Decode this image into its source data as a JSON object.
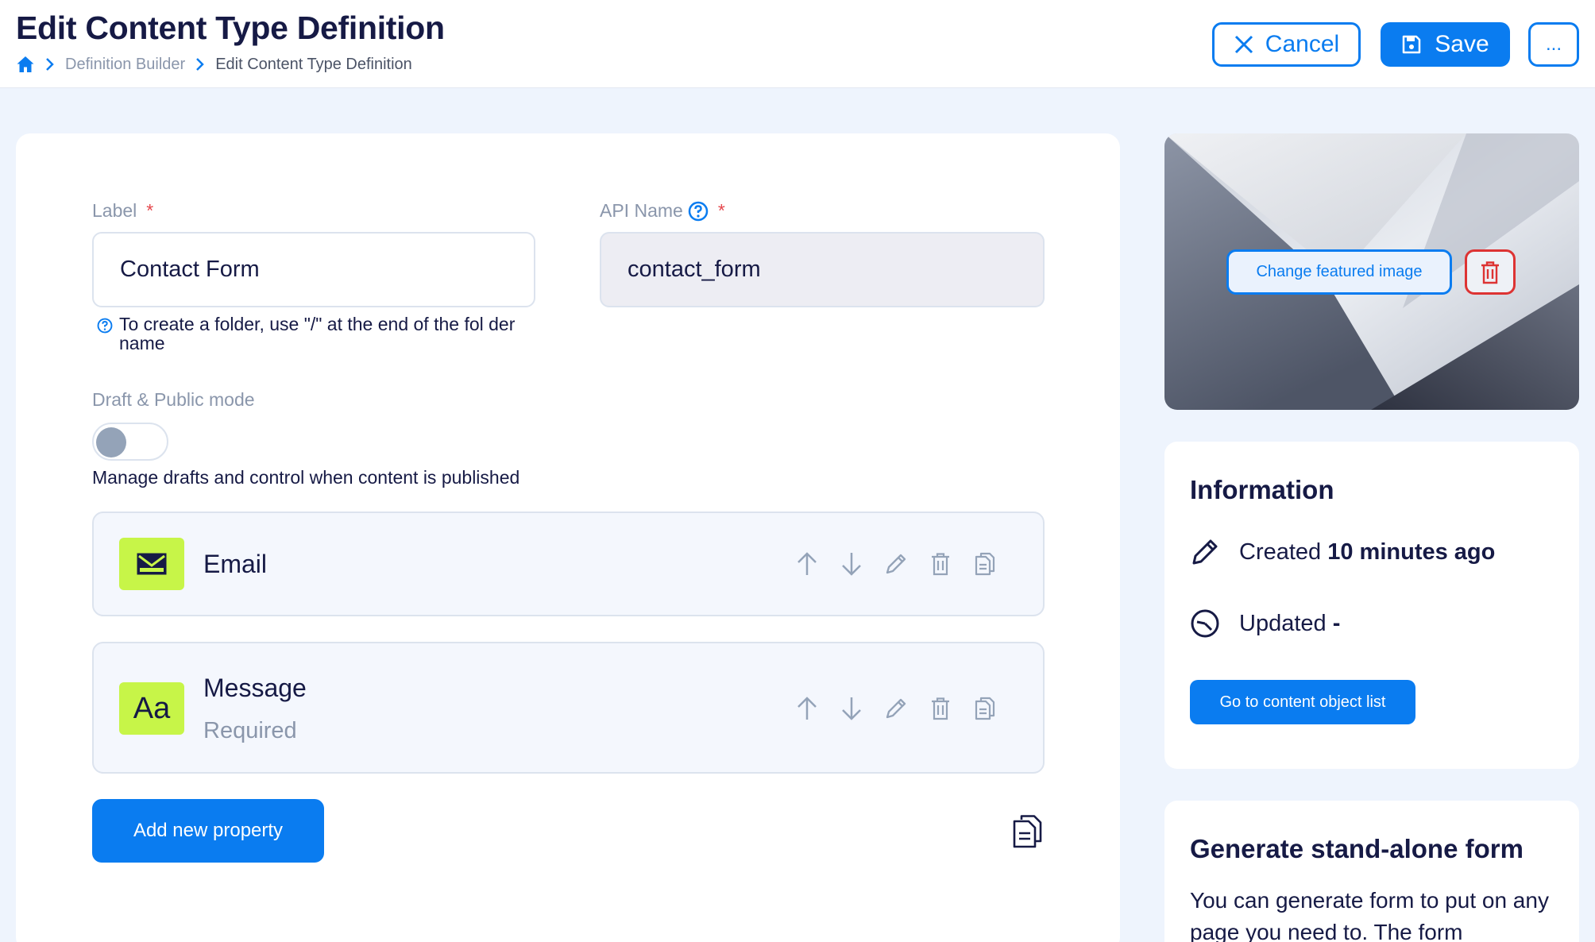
{
  "header": {
    "title": "Edit Content Type Definition",
    "breadcrumb": [
      "Definition Builder",
      "Edit Content Type Definition"
    ],
    "cancel_label": "Cancel",
    "save_label": "Save",
    "more_label": "..."
  },
  "form": {
    "label_field": {
      "label": "Label",
      "required_mark": "*",
      "value": "Contact Form"
    },
    "hint": "To create a folder, use \"/\" at the end of the fol der name",
    "api_field": {
      "label": "API Name",
      "required_mark": "*",
      "value": "contact_form"
    },
    "mode_label": "Draft & Public mode",
    "mode_enabled": false,
    "mode_description": "Manage drafts and control when content is published"
  },
  "properties": [
    {
      "name": "Email",
      "subtitle": "",
      "icon": "envelope-icon"
    },
    {
      "name": "Message",
      "subtitle": "Required",
      "icon": "text-aa-icon"
    }
  ],
  "add_property_label": "Add new property",
  "featured_image": {
    "change_label": "Change featured image"
  },
  "information": {
    "title": "Information",
    "created_label": "Created",
    "created_value": "10 minutes ago",
    "updated_label": "Updated",
    "updated_value": "-",
    "goto_label": "Go to content object list"
  },
  "generate_form": {
    "title": "Generate stand-alone form",
    "text": "You can generate form to put on any page you need to. The form"
  },
  "colors": {
    "accent": "#0a7cf0",
    "title": "#161a45",
    "property_icon_bg": "#c7f548",
    "danger": "#dd3333"
  }
}
